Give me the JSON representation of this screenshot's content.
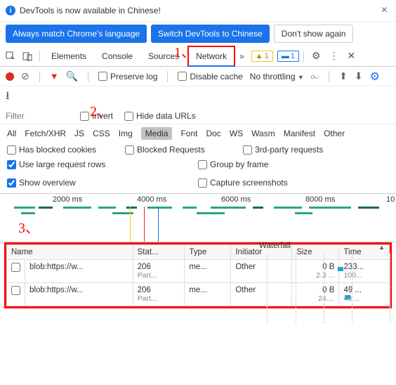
{
  "infobar": {
    "message": "DevTools is now available in Chinese!",
    "btn_match": "Always match Chrome's language",
    "btn_switch": "Switch DevTools to Chinese",
    "btn_dont": "Don't show again"
  },
  "tabs": {
    "elements": "Elements",
    "console": "Console",
    "sources": "Sources",
    "network": "Network",
    "warn_count": "1",
    "info_count": "1"
  },
  "toolbar": {
    "preserve": "Preserve log",
    "disable_cache": "Disable cache",
    "throttle": "No throttling"
  },
  "filter": {
    "placeholder": "Filter",
    "invert": "Invert",
    "hide_urls": "Hide data URLs"
  },
  "types": [
    "All",
    "Fetch/XHR",
    "JS",
    "CSS",
    "Img",
    "Media",
    "Font",
    "Doc",
    "WS",
    "Wasm",
    "Manifest",
    "Other"
  ],
  "type_sel": "Media",
  "opts": {
    "blocked_cookies": "Has blocked cookies",
    "blocked_req": "Blocked Requests",
    "third_party": "3rd-party requests",
    "large_rows": "Use large request rows",
    "group_frame": "Group by frame",
    "overview": "Show overview",
    "capture": "Capture screenshots"
  },
  "timeline": {
    "marks": [
      "2000 ms",
      "4000 ms",
      "6000 ms",
      "8000 ms",
      "10"
    ]
  },
  "table": {
    "headers": [
      "Name",
      "Stat...",
      "Type",
      "Initiator",
      "Size",
      "Time"
    ],
    "waterfall": "Waterfall",
    "rows": [
      {
        "name": "blob:https://w...",
        "status": "206",
        "status2": "Part...",
        "type": "me...",
        "initiator": "Other",
        "size": "0 B",
        "size2": "2.3 ...",
        "time": "233...",
        "time2": "100..."
      },
      {
        "name": "blob:https://w...",
        "status": "206",
        "status2": "Part...",
        "type": "me...",
        "initiator": "Other",
        "size": "0 B",
        "size2": "24....",
        "time": "49 ...",
        "time2": "48 ..."
      }
    ]
  },
  "annotations": {
    "a1": "1、",
    "a2": "2、",
    "a3": "3、"
  }
}
